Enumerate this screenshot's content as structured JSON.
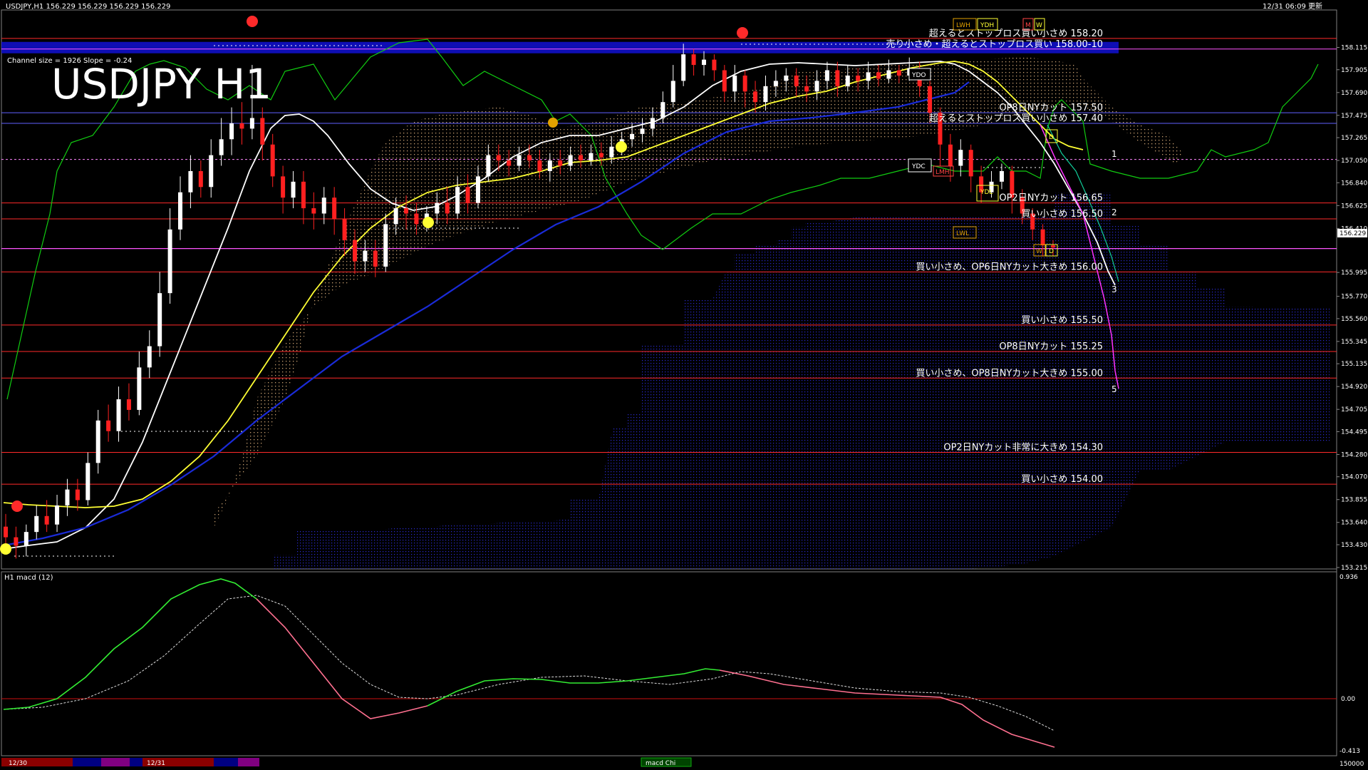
{
  "header": {
    "symbol_info": "USDJPY,H1  156.229 156.229 156.229 156.229",
    "big_title": "USDJPY H1",
    "channel_info": "Channel size = 1926 Slope = -0.24",
    "timestamp": "12/31 06:09 更新"
  },
  "macd": {
    "title": "H1  macd (12)",
    "axis_top": "0.936",
    "axis_zero": "0.00",
    "axis_bottom": "-0.413",
    "bottom_right": "150000",
    "tab_label": "macd Chi"
  },
  "time_labels": [
    "12/30",
    "12/31"
  ],
  "colors": {
    "bg": "#000000",
    "resistance": "#ff2a2a",
    "support_magenta": "#ff55ff",
    "blue_line": "#6060ff",
    "ma_white": "#ffffff",
    "ma_yellow": "#ffff33",
    "ma_blue": "#1a2bd8",
    "chikou_green": "#11cc11",
    "cloud_blue": "#2424c0",
    "cloud_tan": "#c8a070",
    "macd_green": "#33ee33",
    "macd_pink": "#ff7090"
  },
  "chart_data": {
    "type": "candlestick",
    "instrument": "USDJPY",
    "timeframe": "H1",
    "ylim": [
      153.215,
      158.32
    ],
    "y_ticks": [
      "158.115",
      "157.905",
      "157.690",
      "157.475",
      "157.265",
      "157.050",
      "156.840",
      "156.625",
      "156.410",
      "155.995",
      "155.770",
      "155.560",
      "155.345",
      "155.135",
      "154.920",
      "154.705",
      "154.495",
      "154.280",
      "154.070",
      "153.855",
      "153.640",
      "153.430",
      "153.215"
    ],
    "current_price": "156.229",
    "levels": [
      {
        "price": 158.2,
        "label": "超えるとストップロス買い小さめ 158.20",
        "type": "resistance"
      },
      {
        "price": 158.1,
        "label": "売り小さめ・超えるとストップロス買い 158.00-10",
        "type": "zone"
      },
      {
        "price": 157.5,
        "label": "OP8日NYカット 157.50",
        "type": "option"
      },
      {
        "price": 157.4,
        "label": "超えるとストップロス買い小さめ 157.40",
        "type": "stop"
      },
      {
        "price": 156.65,
        "label": "OP2日NYカット 156.65",
        "type": "option"
      },
      {
        "price": 156.5,
        "label": "買い小さめ 156.50",
        "type": "support"
      },
      {
        "price": 156.0,
        "label": "買い小さめ、OP6日NYカット大きめ 156.00",
        "type": "support"
      },
      {
        "price": 155.5,
        "label": "買い小さめ 155.50",
        "type": "support"
      },
      {
        "price": 155.25,
        "label": "OP8日NYカット 155.25",
        "type": "option"
      },
      {
        "price": 155.0,
        "label": "買い小さめ、OP8日NYカット大きめ 155.00",
        "type": "support"
      },
      {
        "price": 154.3,
        "label": "OP2日NYカット非常に大きめ 154.30",
        "type": "option"
      },
      {
        "price": 154.0,
        "label": "買い小さめ 154.00",
        "type": "support"
      }
    ],
    "markers": [
      "LWH",
      "YDH",
      "M",
      "W",
      "YDO",
      "YDC",
      "LMH",
      "YDL",
      "LWL",
      "D",
      "W",
      "D"
    ],
    "projection_labels": [
      "1",
      "2",
      "3",
      "5"
    ],
    "candles": [
      [
        153.6,
        153.5,
        153.72,
        153.38
      ],
      [
        153.5,
        153.42,
        153.6,
        153.3
      ],
      [
        153.42,
        153.55,
        153.62,
        153.32
      ],
      [
        153.55,
        153.7,
        153.8,
        153.48
      ],
      [
        153.7,
        153.62,
        153.85,
        153.55
      ],
      [
        153.62,
        153.8,
        153.9,
        153.55
      ],
      [
        153.8,
        153.95,
        154.05,
        153.7
      ],
      [
        153.95,
        153.85,
        154.05,
        153.75
      ],
      [
        153.85,
        154.2,
        154.3,
        153.8
      ],
      [
        154.2,
        154.6,
        154.7,
        154.1
      ],
      [
        154.6,
        154.5,
        154.75,
        154.4
      ],
      [
        154.5,
        154.8,
        154.92,
        154.4
      ],
      [
        154.8,
        154.7,
        154.95,
        154.6
      ],
      [
        154.7,
        155.1,
        155.25,
        154.65
      ],
      [
        155.1,
        155.3,
        155.45,
        155.0
      ],
      [
        155.3,
        155.8,
        156.0,
        155.2
      ],
      [
        155.8,
        156.4,
        156.6,
        155.7
      ],
      [
        156.4,
        156.75,
        156.9,
        156.3
      ],
      [
        156.75,
        156.95,
        157.1,
        156.6
      ],
      [
        156.95,
        156.8,
        157.05,
        156.7
      ],
      [
        156.8,
        157.1,
        157.25,
        156.7
      ],
      [
        157.1,
        157.25,
        157.45,
        157.0
      ],
      [
        157.25,
        157.4,
        157.55,
        157.1
      ],
      [
        157.4,
        157.35,
        157.6,
        157.2
      ],
      [
        157.35,
        157.45,
        157.95,
        157.25
      ],
      [
        157.45,
        157.2,
        157.55,
        157.05
      ],
      [
        157.2,
        156.9,
        157.3,
        156.8
      ],
      [
        156.9,
        156.7,
        157.0,
        156.55
      ],
      [
        156.7,
        156.85,
        156.95,
        156.6
      ],
      [
        156.85,
        156.6,
        156.95,
        156.45
      ],
      [
        156.6,
        156.55,
        156.75,
        156.4
      ],
      [
        156.55,
        156.7,
        156.8,
        156.45
      ],
      [
        156.7,
        156.5,
        156.8,
        156.35
      ],
      [
        156.5,
        156.3,
        156.6,
        156.15
      ],
      [
        156.3,
        156.1,
        156.4,
        155.98
      ],
      [
        156.1,
        156.2,
        156.3,
        156.0
      ],
      [
        156.2,
        156.05,
        156.3,
        155.95
      ],
      [
        156.05,
        156.45,
        156.55,
        156.0
      ],
      [
        156.45,
        156.6,
        156.7,
        156.35
      ],
      [
        156.6,
        156.55,
        156.72,
        156.4
      ],
      [
        156.55,
        156.45,
        156.65,
        156.35
      ],
      [
        156.45,
        156.55,
        156.62,
        156.38
      ],
      [
        156.55,
        156.65,
        156.75,
        156.45
      ],
      [
        156.65,
        156.55,
        156.8,
        156.45
      ],
      [
        156.55,
        156.8,
        156.9,
        156.5
      ],
      [
        156.8,
        156.65,
        156.92,
        156.55
      ],
      [
        156.65,
        156.9,
        157.0,
        156.6
      ],
      [
        156.9,
        157.1,
        157.2,
        156.85
      ],
      [
        157.1,
        157.05,
        157.2,
        156.95
      ],
      [
        157.05,
        157.0,
        157.15,
        156.9
      ],
      [
        157.0,
        157.1,
        157.18,
        156.95
      ],
      [
        157.1,
        157.05,
        157.2,
        156.98
      ],
      [
        157.05,
        156.95,
        157.15,
        156.88
      ],
      [
        156.95,
        157.05,
        157.12,
        156.85
      ],
      [
        157.05,
        157.0,
        157.15,
        156.92
      ],
      [
        157.0,
        157.1,
        157.18,
        156.95
      ],
      [
        157.1,
        157.05,
        157.2,
        156.98
      ],
      [
        157.05,
        157.12,
        157.2,
        157.0
      ],
      [
        157.12,
        157.08,
        157.22,
        157.0
      ],
      [
        157.08,
        157.18,
        157.28,
        157.02
      ],
      [
        157.18,
        157.25,
        157.32,
        157.1
      ],
      [
        157.25,
        157.3,
        157.4,
        157.18
      ],
      [
        157.3,
        157.35,
        157.45,
        157.22
      ],
      [
        157.35,
        157.45,
        157.55,
        157.28
      ],
      [
        157.45,
        157.6,
        157.7,
        157.4
      ],
      [
        157.6,
        157.8,
        157.95,
        157.55
      ],
      [
        157.8,
        158.05,
        158.15,
        157.75
      ],
      [
        158.05,
        157.95,
        158.1,
        157.85
      ],
      [
        157.95,
        158.0,
        158.08,
        157.85
      ],
      [
        158.0,
        157.9,
        158.05,
        157.8
      ],
      [
        157.9,
        157.7,
        157.95,
        157.6
      ],
      [
        157.7,
        157.85,
        157.95,
        157.6
      ],
      [
        157.85,
        157.7,
        157.9,
        157.55
      ],
      [
        157.7,
        157.6,
        157.8,
        157.5
      ],
      [
        157.6,
        157.75,
        157.85,
        157.52
      ],
      [
        157.75,
        157.8,
        157.9,
        157.65
      ],
      [
        157.8,
        157.85,
        157.92,
        157.7
      ],
      [
        157.85,
        157.75,
        157.92,
        157.65
      ],
      [
        157.75,
        157.7,
        157.85,
        157.6
      ],
      [
        157.7,
        157.8,
        157.9,
        157.62
      ],
      [
        157.8,
        157.9,
        157.98,
        157.72
      ],
      [
        157.9,
        157.75,
        157.98,
        157.65
      ],
      [
        157.75,
        157.85,
        157.95,
        157.7
      ],
      [
        157.85,
        157.8,
        157.92,
        157.7
      ],
      [
        157.8,
        157.88,
        157.98,
        157.72
      ],
      [
        157.88,
        157.82,
        157.95,
        157.75
      ],
      [
        157.82,
        157.9,
        158.0,
        157.78
      ],
      [
        157.9,
        157.85,
        157.95,
        157.78
      ],
      [
        157.85,
        157.92,
        158.02,
        157.8
      ],
      [
        157.92,
        157.75,
        157.98,
        157.65
      ],
      [
        157.75,
        157.5,
        157.8,
        157.4
      ],
      [
        157.5,
        157.2,
        157.55,
        157.0
      ],
      [
        157.2,
        157.0,
        157.3,
        156.85
      ],
      [
        157.0,
        157.15,
        157.25,
        156.9
      ],
      [
        157.15,
        156.9,
        157.2,
        156.75
      ],
      [
        156.9,
        156.75,
        157.0,
        156.65
      ],
      [
        156.75,
        156.85,
        156.95,
        156.7
      ],
      [
        156.85,
        156.95,
        157.02,
        156.78
      ],
      [
        156.95,
        156.7,
        157.0,
        156.55
      ],
      [
        156.7,
        156.55,
        156.78,
        156.45
      ],
      [
        156.55,
        156.4,
        156.6,
        156.3
      ],
      [
        156.4,
        156.25,
        156.45,
        156.15
      ],
      [
        156.25,
        156.23,
        156.3,
        156.15
      ]
    ]
  }
}
